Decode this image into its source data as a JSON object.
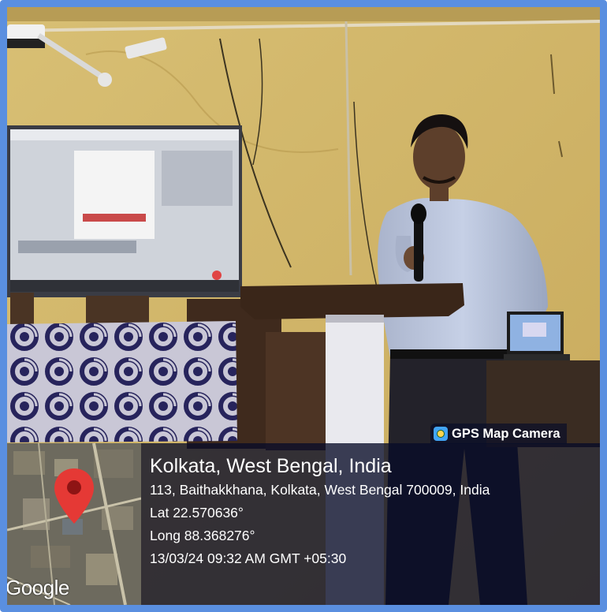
{
  "overlay": {
    "brand_label": "GPS Map Camera",
    "brand_icon": "gps-map-camera-icon",
    "location_title": "Kolkata, West Bengal, India",
    "address": "113, Baithakkhana, Kolkata, West Bengal 700009, India",
    "latitude": "Lat 22.570636°",
    "longitude": "Long 88.368276°",
    "datetime": "13/03/24 09:32 AM GMT +05:30",
    "map_logo": "Google",
    "map_pin_icon": "map-pin-icon"
  },
  "colors": {
    "frame_border": "#5a8fe0",
    "wall": "#d3b768",
    "overlay_bg": "#080c28",
    "pin": "#e53935"
  }
}
